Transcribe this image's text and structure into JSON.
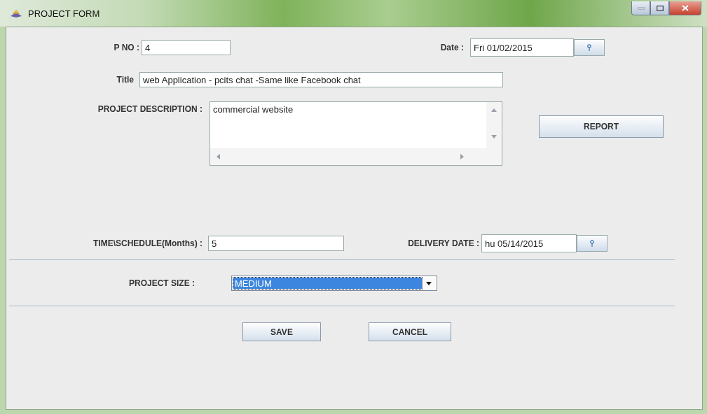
{
  "window": {
    "title": "PROJECT FORM"
  },
  "p_no": {
    "label": "P NO :",
    "value": "4"
  },
  "date": {
    "label": "Date :",
    "value": "Fri 01/02/2015"
  },
  "title": {
    "label": "Title",
    "value": "web Application - pcits chat -Same like Facebook chat"
  },
  "description": {
    "label": "PROJECT DESCRIPTION :",
    "value": "commercial website"
  },
  "report_button": "REPORT",
  "schedule": {
    "label": "TIME\\SCHEDULE(Months) :",
    "value": "5"
  },
  "delivery_date": {
    "label": "DELIVERY DATE :",
    "value": "hu 05/14/2015"
  },
  "project_size": {
    "label": "PROJECT SIZE :",
    "value": "MEDIUM"
  },
  "buttons": [
    "SAVE",
    "CANCEL"
  ]
}
